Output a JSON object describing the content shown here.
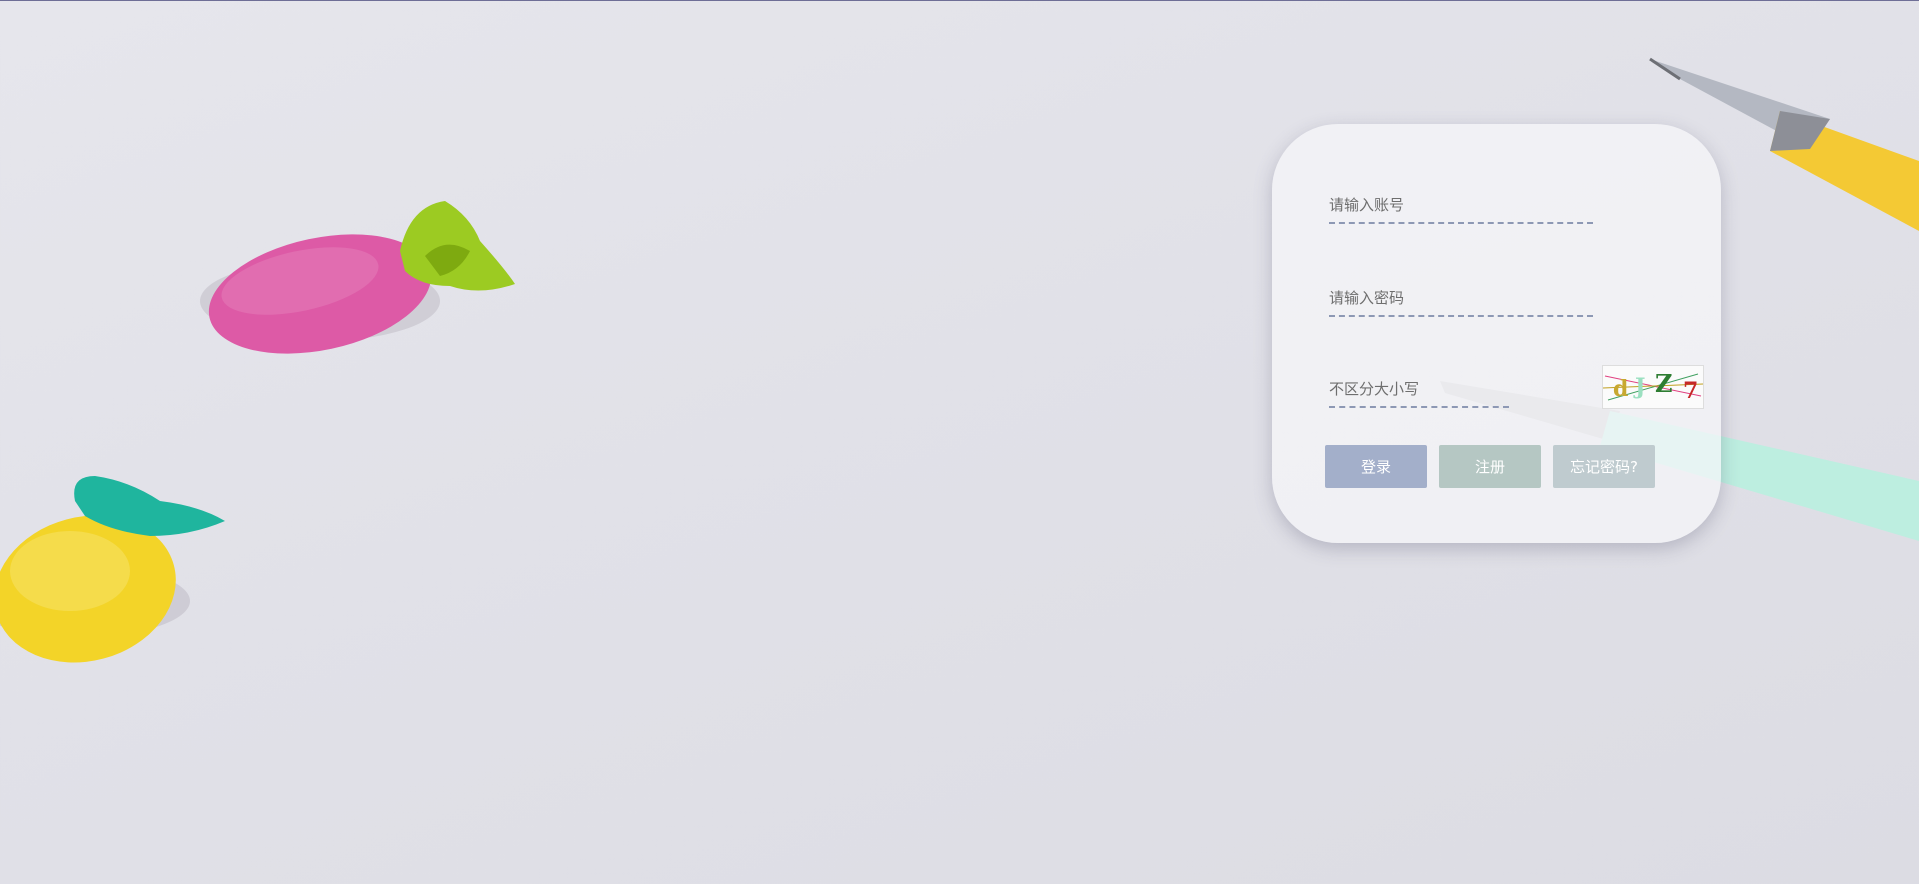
{
  "login": {
    "account_placeholder": "请输入账号",
    "password_placeholder": "请输入密码",
    "captcha_placeholder": "不区分大小写",
    "captcha_text": "dJZ7",
    "login_button": "登录",
    "register_button": "注册",
    "forgot_button": "忘记密码?"
  },
  "colors": {
    "login_button": "#a3afca",
    "register_button": "#b5c7c3",
    "forgot_button": "#bfcbcf",
    "field_underline": "#8d98b4"
  }
}
